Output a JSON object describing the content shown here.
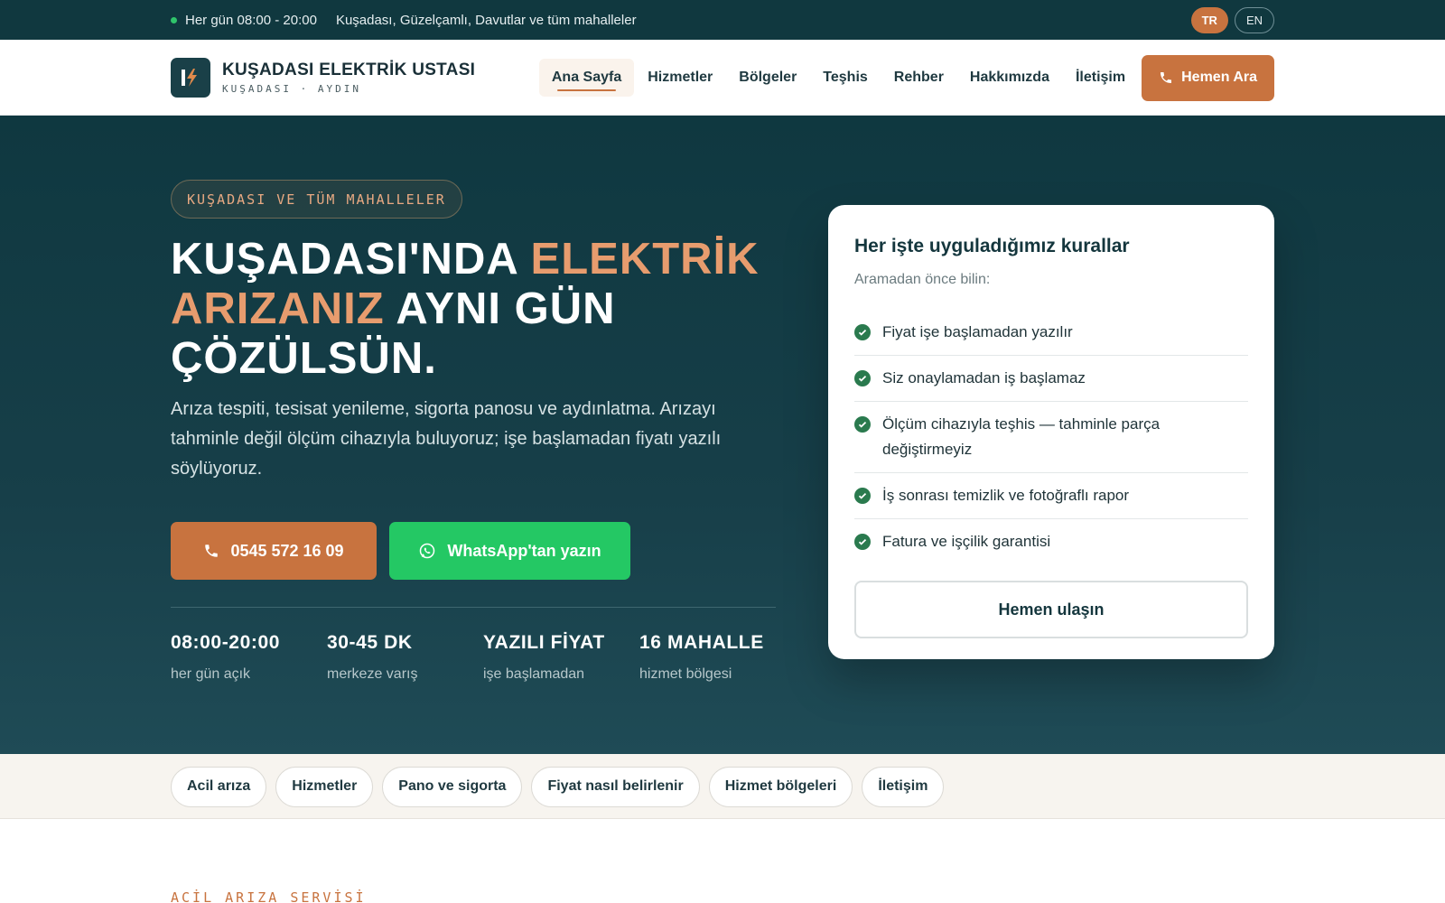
{
  "topbar": {
    "hours": "Her gün 08:00 - 20:00",
    "areas": "Kuşadası, Güzelçamlı, Davutlar ve tüm mahalleler",
    "lang": [
      "TR",
      "EN"
    ]
  },
  "header": {
    "brand_name": "KUŞADASI ELEKTRİK USTASI",
    "brand_sub": "KUŞADASI · AYDIN",
    "nav": [
      "Ana Sayfa",
      "Hizmetler",
      "Bölgeler",
      "Teşhis",
      "Rehber",
      "Hakkımızda",
      "İletişim"
    ],
    "call_label": "Hemen Ara"
  },
  "hero": {
    "badge": "KUŞADASI VE TÜM MAHALLELER",
    "headline": {
      "part1": "KUŞADASI'NDA ",
      "accent1": "ELEKTRİK",
      "accent2": "ARIZANIZ",
      "part2": " AYNI GÜN",
      "part3": "ÇÖZÜLSÜN."
    },
    "lead": "Arıza tespiti, tesisat yenileme, sigorta panosu ve aydınlatma. Arızayı tahminle değil ölçüm cihazıyla buluyoruz; işe başlamadan fiyatı yazılı söylüyoruz.",
    "phone_label": "0545 572 16 09",
    "whatsapp_label": "WhatsApp'tan yazın",
    "stats": [
      {
        "value": "08:00-20:00",
        "label": "her gün açık"
      },
      {
        "value": "30-45 DK",
        "label": "merkeze varış"
      },
      {
        "value": "YAZILI FİYAT",
        "label": "işe başlamadan"
      },
      {
        "value": "16 MAHALLE",
        "label": "hizmet bölgesi"
      }
    ]
  },
  "card": {
    "title": "Her işte uyguladığımız kurallar",
    "subtitle": "Aramadan önce bilin:",
    "rules": [
      "Fiyat işe başlamadan yazılır",
      "Siz onaylamadan iş başlamaz",
      "Ölçüm cihazıyla teşhis — tahminle parça değiştirmeyiz",
      "İş sonrası temizlik ve fotoğraflı rapor",
      "Fatura ve işçilik garantisi"
    ],
    "button": "Hemen ulaşın"
  },
  "chips": [
    "Acil arıza",
    "Hizmetler",
    "Pano ve sigorta",
    "Fiyat nasıl belirlenir",
    "Hizmet bölgeleri",
    "İletişim"
  ],
  "section": {
    "eyebrow": "ACİL ARIZA SERVİSİ"
  },
  "colors": {
    "primary_dark": "#10383f",
    "accent": "#c8733f",
    "accent_light": "#e79c6e",
    "whatsapp": "#24c864",
    "check": "#2a7a4e"
  }
}
